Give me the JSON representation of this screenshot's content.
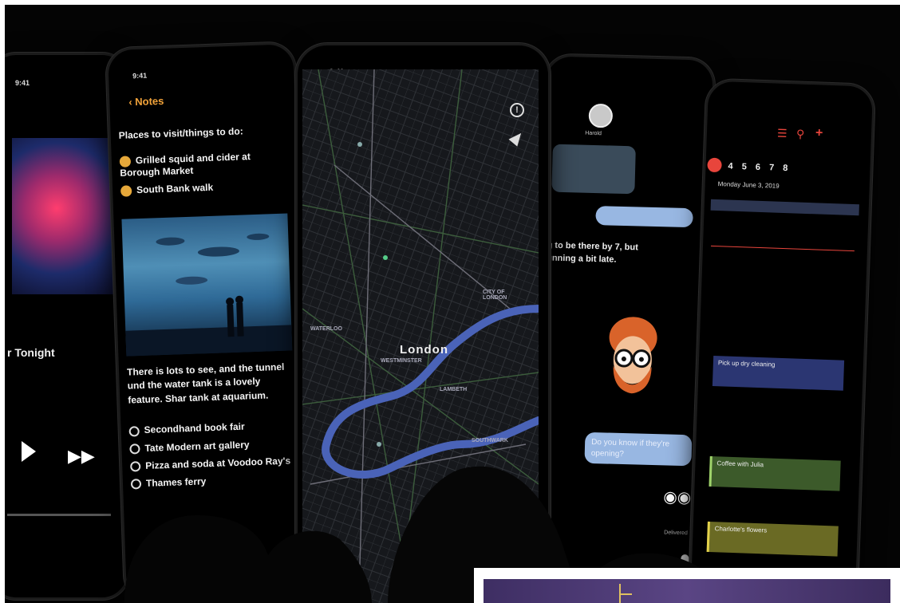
{
  "music": {
    "status_time": "9:41",
    "song_fragment": "r Tonight"
  },
  "notes": {
    "status_time": "9:41",
    "back_label": "Notes",
    "heading": "Places to visit/things to do:",
    "checked_items": [
      "Grilled squid and cider at Borough Market",
      "South Bank walk"
    ],
    "paragraph": "There is lots to see, and the tunnel und the water tank is a lovely feature. Shar tank at aquarium.",
    "unchecked_items": [
      "Secondhand book fair",
      "Tate Modern art gallery",
      "Pizza and soda at Voodoo Ray's",
      "Thames ferry"
    ]
  },
  "map": {
    "status_time": "9:41",
    "city_label": "London",
    "district_label": "WESTMINSTER",
    "area_labels": [
      "CITY OF LONDON",
      "SOUTHWARK",
      "LAMBETH",
      "WATERLOO"
    ]
  },
  "messages": {
    "contact": "Harold",
    "incoming_text": "g to be there by 7, but unning a bit late.",
    "outgoing_text": "Do you know if they're opening?",
    "delivered": "Delivered"
  },
  "calendar": {
    "date_numbers": [
      "4",
      "5",
      "6",
      "7",
      "8"
    ],
    "date_label": "Monday June 3, 2019",
    "events": [
      "Pick up dry cleaning",
      "Coffee with Julia",
      "Charlotte's flowers"
    ],
    "accent_color": "#e8453c"
  }
}
